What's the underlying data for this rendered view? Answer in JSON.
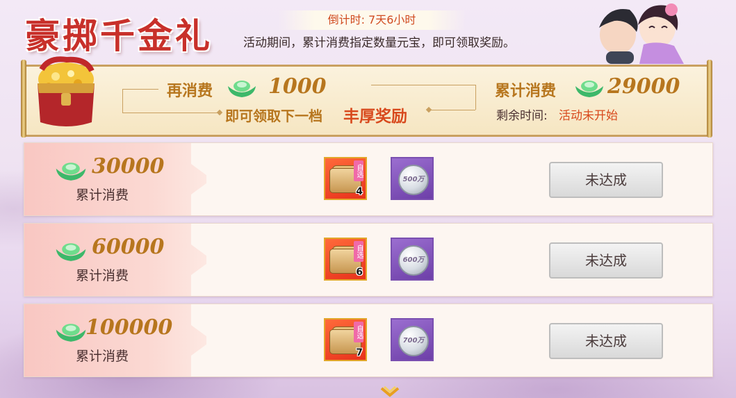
{
  "header": {
    "title": "豪掷千金礼",
    "countdown": "倒计时: 7天6小时",
    "description": "活动期间，累计消费指定数量元宝，即可领取奖励。"
  },
  "banner": {
    "spend_more_label": "再消费",
    "spend_more_amount": "1000",
    "next_tier_text": "即可领取下一档",
    "reward_text": "丰厚奖励",
    "total_spent_label": "累计消费",
    "total_spent_amount": "29000",
    "remaining_label": "剩余时间:",
    "remaining_value": "活动未开始"
  },
  "tiers": [
    {
      "amount": "30000",
      "label": "累计消费",
      "box_tag": "自选",
      "box_count": "4",
      "coin_text": "500万",
      "button": "未达成"
    },
    {
      "amount": "60000",
      "label": "累计消费",
      "box_tag": "自选",
      "box_count": "6",
      "coin_text": "600万",
      "button": "未达成"
    },
    {
      "amount": "100000",
      "label": "累计消费",
      "box_tag": "自选",
      "box_count": "7",
      "coin_text": "700万",
      "button": "未达成"
    }
  ],
  "colors": {
    "title": "#c8302a",
    "gold_text": "#b7761e",
    "countdown": "#d04a20",
    "reward_red": "#d84a1e"
  },
  "icons": {
    "ingot": "yuanbao-ingot-icon",
    "chest": "treasure-chest-icon",
    "scroll_down": "chevron-down-icon"
  }
}
